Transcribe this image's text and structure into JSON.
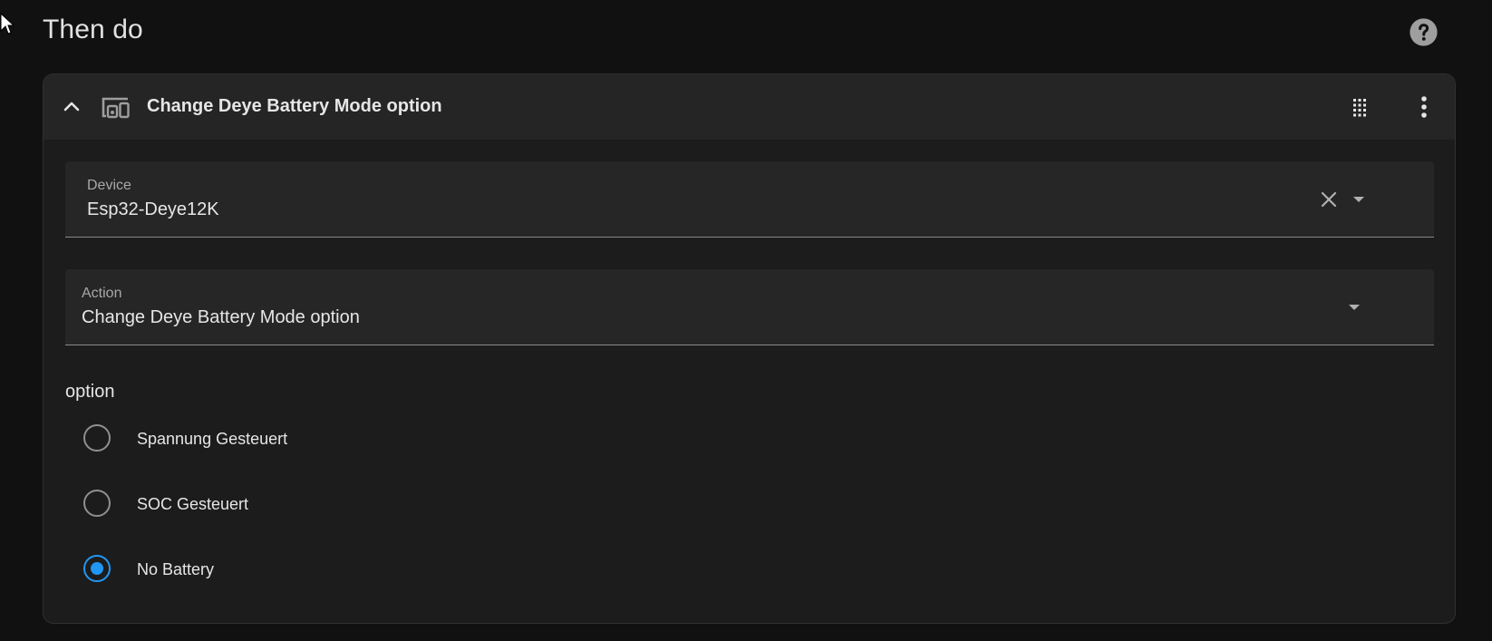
{
  "section": {
    "title": "Then do",
    "help_icon": "help-circle-icon"
  },
  "card": {
    "title": "Change Deye Battery Mode option",
    "icons": {
      "collapse": "chevron-up-icon",
      "type": "devices-icon",
      "drag": "drag-handle-icon",
      "menu": "more-vertical-icon"
    },
    "device_field": {
      "label": "Device",
      "value": "Esp32-Deye12K"
    },
    "action_field": {
      "label": "Action",
      "value": "Change Deye Battery Mode option"
    },
    "option_group": {
      "heading": "option",
      "options": [
        {
          "label": "Spannung Gesteuert",
          "checked": false
        },
        {
          "label": "SOC Gesteuert",
          "checked": false
        },
        {
          "label": "No Battery",
          "checked": true
        }
      ]
    }
  },
  "colors": {
    "background": "#111111",
    "card": "#1c1c1c",
    "header": "#252525",
    "field": "#262626",
    "accent": "#2196f3",
    "text": "#e1e1e1"
  }
}
